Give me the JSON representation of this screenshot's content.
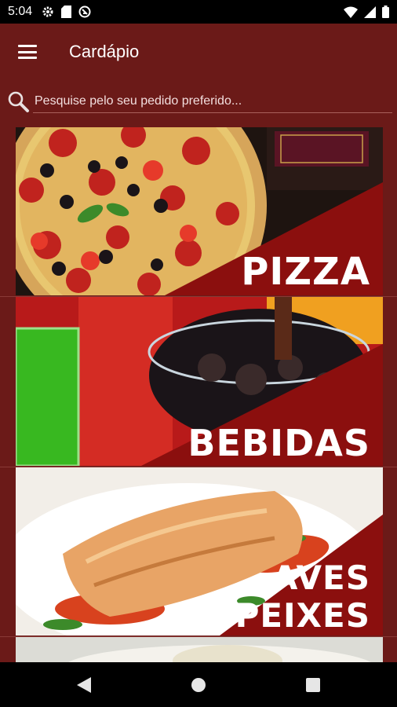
{
  "status_bar": {
    "time": "5:04",
    "left_icons": [
      "gear-icon",
      "sd-card-icon",
      "no-data-icon"
    ],
    "right_icons": [
      "wifi-icon",
      "signal-icon",
      "battery-icon"
    ]
  },
  "app_bar": {
    "menu_icon": "hamburger-icon",
    "title": "Cardápio"
  },
  "search": {
    "icon": "search-icon",
    "placeholder": "Pesquise pelo seu pedido preferido..."
  },
  "categories": [
    {
      "label": "PIZZA",
      "image": "pizza-photo"
    },
    {
      "label": "BEBIDAS",
      "image": "drinks-photo"
    },
    {
      "label": "AVES\nE PEIXES",
      "label_line1": "AVES",
      "label_line2": "E PEIXES",
      "image": "grilled-fish-photo"
    },
    {
      "label": "",
      "image": "rice-dish-photo"
    }
  ],
  "nav_bar": {
    "back": "back-icon",
    "home": "home-icon",
    "recents": "recents-icon"
  },
  "colors": {
    "primary": "#6b1a18",
    "banner": "#8b0f0e",
    "status_bar": "#000000"
  }
}
